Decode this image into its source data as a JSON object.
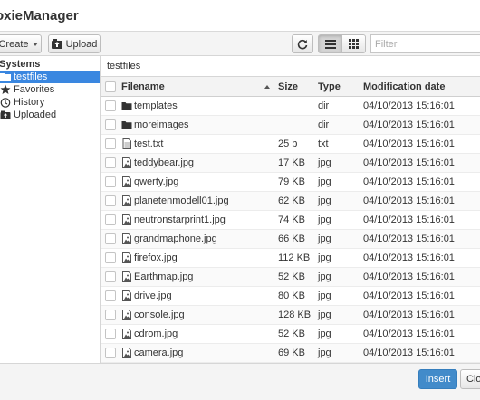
{
  "window": {
    "title": "oxieManager"
  },
  "toolbar": {
    "create_label": "Create",
    "upload_label": "Upload",
    "filter_placeholder": "Filter"
  },
  "sidebar": {
    "heading": "eSystems",
    "items": [
      {
        "label": "testfiles",
        "icon": "folder-icon",
        "selected": true
      },
      {
        "label": "Favorites",
        "icon": "star-icon"
      },
      {
        "label": "History",
        "icon": "clock-icon"
      },
      {
        "label": "Uploaded",
        "icon": "upload-folder-icon"
      }
    ]
  },
  "main": {
    "path": "testfiles",
    "columns": {
      "filename": "Filename",
      "size": "Size",
      "type": "Type",
      "date": "Modification date"
    },
    "files": [
      {
        "name": "templates",
        "size": "",
        "type": "dir",
        "date": "04/10/2013 15:16:01",
        "icon": "folder"
      },
      {
        "name": "moreimages",
        "size": "",
        "type": "dir",
        "date": "04/10/2013 15:16:01",
        "icon": "folder"
      },
      {
        "name": "test.txt",
        "size": "25 b",
        "type": "txt",
        "date": "04/10/2013 15:16:01",
        "icon": "doc"
      },
      {
        "name": "teddybear.jpg",
        "size": "17 KB",
        "type": "jpg",
        "date": "04/10/2013 15:16:01",
        "icon": "image"
      },
      {
        "name": "qwerty.jpg",
        "size": "79 KB",
        "type": "jpg",
        "date": "04/10/2013 15:16:01",
        "icon": "image"
      },
      {
        "name": "planetenmodell01.jpg",
        "size": "62 KB",
        "type": "jpg",
        "date": "04/10/2013 15:16:01",
        "icon": "image"
      },
      {
        "name": "neutronstarprint1.jpg",
        "size": "74 KB",
        "type": "jpg",
        "date": "04/10/2013 15:16:01",
        "icon": "image"
      },
      {
        "name": "grandmaphone.jpg",
        "size": "66 KB",
        "type": "jpg",
        "date": "04/10/2013 15:16:01",
        "icon": "image"
      },
      {
        "name": "firefox.jpg",
        "size": "112 KB",
        "type": "jpg",
        "date": "04/10/2013 15:16:01",
        "icon": "image"
      },
      {
        "name": "Earthmap.jpg",
        "size": "52 KB",
        "type": "jpg",
        "date": "04/10/2013 15:16:01",
        "icon": "image"
      },
      {
        "name": "drive.jpg",
        "size": "80 KB",
        "type": "jpg",
        "date": "04/10/2013 15:16:01",
        "icon": "image"
      },
      {
        "name": "console.jpg",
        "size": "128 KB",
        "type": "jpg",
        "date": "04/10/2013 15:16:01",
        "icon": "image"
      },
      {
        "name": "cdrom.jpg",
        "size": "52 KB",
        "type": "jpg",
        "date": "04/10/2013 15:16:01",
        "icon": "image"
      },
      {
        "name": "camera.jpg",
        "size": "69 KB",
        "type": "jpg",
        "date": "04/10/2013 15:16:01",
        "icon": "image"
      }
    ]
  },
  "footer": {
    "insert_label": "Insert",
    "close_label": "Close"
  },
  "colors": {
    "accent": "#428bca",
    "selection": "#3a87e0"
  }
}
